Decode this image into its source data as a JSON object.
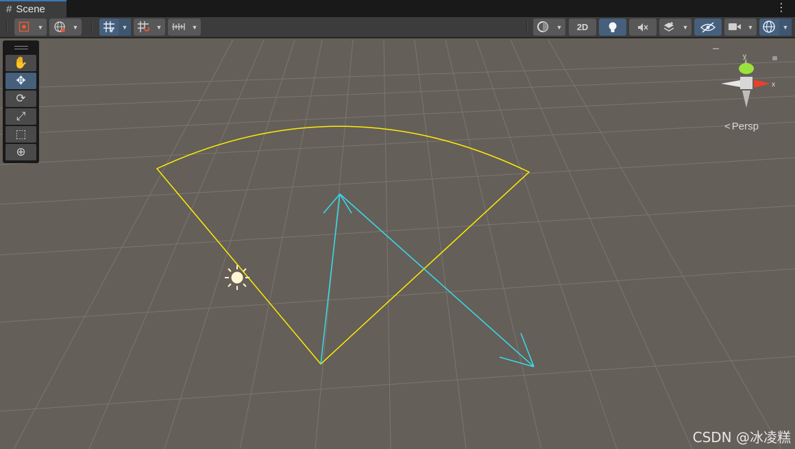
{
  "tab": {
    "icon": "scene-grid-icon",
    "glyph": "#",
    "title": "Scene"
  },
  "tab_menu": "⋮",
  "toolbar": {
    "left": [
      {
        "name": "draw-mode-button",
        "icon": "shaded-mode-icon"
      },
      {
        "name": "global-local-button",
        "icon": "globe-icon"
      },
      {
        "name": "grid-snap-button",
        "icon": "grid-icon"
      },
      {
        "name": "increment-snap-button",
        "icon": "magnet-grid-icon"
      },
      {
        "name": "ruler-button",
        "icon": "ruler-icon"
      }
    ],
    "right": {
      "render_mode_icon": "draw-mode-icon",
      "two_d_label": "2D",
      "lighting_icon": "lightbulb-icon",
      "audio_icon": "audio-mute-icon",
      "effects_icon": "effects-layers-icon",
      "visibility_icon": "scene-visibility-icon",
      "camera_icon": "camera-icon",
      "gizmos_icon": "gizmos-globe-icon"
    }
  },
  "tools": [
    {
      "name": "view-tool",
      "icon": "hand-icon",
      "glyph": "✋",
      "active": false
    },
    {
      "name": "move-tool",
      "icon": "move-arrows-icon",
      "glyph": "✥",
      "active": true
    },
    {
      "name": "rotate-tool",
      "icon": "rotate-icon",
      "glyph": "⟳",
      "active": false
    },
    {
      "name": "scale-tool",
      "icon": "scale-icon",
      "glyph": "⤢",
      "active": false
    },
    {
      "name": "rect-tool",
      "icon": "rect-transform-icon",
      "glyph": "⬚",
      "active": false
    },
    {
      "name": "transform-tool",
      "icon": "transform-all-icon",
      "glyph": "⊕",
      "active": false
    }
  ],
  "gizmo": {
    "y_label": "y",
    "x_label": "x"
  },
  "projection": {
    "chevron": "<",
    "label": "Persp"
  },
  "colors": {
    "viewport": "#655f59",
    "fov_wedge": "#ffee00",
    "arrows": "#33e0ee",
    "active_tool": "#46607c",
    "gizmo_y": "#9be33c",
    "gizmo_x": "#e8402a"
  },
  "watermark": "CSDN @冰凌糕"
}
